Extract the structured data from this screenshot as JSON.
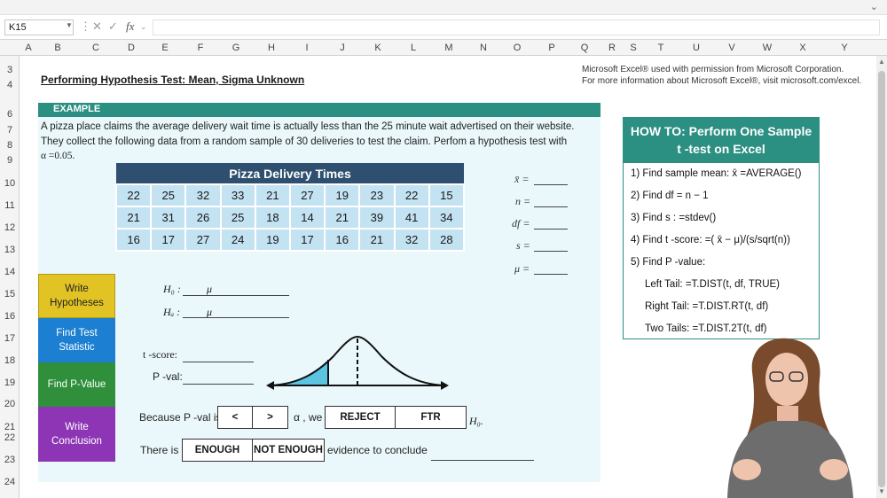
{
  "formula_bar": {
    "cell_ref": "K15",
    "fx": "fx",
    "formula": ""
  },
  "columns": [
    "A",
    "B",
    "C",
    "D",
    "E",
    "F",
    "G",
    "H",
    "I",
    "J",
    "K",
    "L",
    "M",
    "N",
    "O",
    "P",
    "Q",
    "R",
    "S",
    "T",
    "U",
    "V",
    "W",
    "X",
    "Y"
  ],
  "rows": [
    "3",
    "4",
    "6",
    "7",
    "8",
    "9",
    "10",
    "11",
    "12",
    "13",
    "14",
    "15",
    "16",
    "17",
    "18",
    "19",
    "20",
    "21",
    "22",
    "23",
    "24"
  ],
  "title": "Performing Hypothesis Test: Mean, Sigma Unknown",
  "credit": {
    "line1": "Microsoft Excel® used with permission from Microsoft Corporation.",
    "line2": "For more information about Microsoft Excel®, visit microsoft.com/excel."
  },
  "example_label": "EXAMPLE",
  "problem": {
    "line1": "A pizza place claims the average delivery wait time is actually less than the 25 minute wait advertised on their website.",
    "line2": "They collect the following data from a random sample of 30 deliveries to test the claim. Perfom a hypothesis test with",
    "line3": "α =0.05."
  },
  "table": {
    "title": "Pizza Delivery Times",
    "rows": [
      [
        "22",
        "25",
        "32",
        "33",
        "21",
        "27",
        "19",
        "23",
        "22",
        "15"
      ],
      [
        "21",
        "31",
        "26",
        "25",
        "18",
        "14",
        "21",
        "39",
        "41",
        "34"
      ],
      [
        "16",
        "17",
        "27",
        "24",
        "19",
        "17",
        "16",
        "21",
        "32",
        "28"
      ]
    ]
  },
  "stats": {
    "xbar": "x̄ =",
    "n": "n =",
    "df": "df =",
    "s": "s =",
    "mu": "μ ="
  },
  "steps": {
    "hypotheses": "Write Hypotheses",
    "test_stat": "Find Test Statistic",
    "p_value": "Find P-Value",
    "conclusion": "Write Conclusion"
  },
  "hypotheses": {
    "h0": "H₀ :",
    "ha": "Hₐ :",
    "mu": "μ"
  },
  "test_stat": {
    "t_label": "t -score:",
    "p_label": "P -val:"
  },
  "because": {
    "prefix": "Because P -val is",
    "less": "<",
    "greater": ">",
    "alpha_we": "α , we",
    "reject": "REJECT",
    "ftr": "FTR",
    "h0": "H₀."
  },
  "conclusion": {
    "there_is": "There is",
    "enough": "ENOUGH",
    "not_enough": "NOT ENOUGH",
    "evidence": "evidence to conclude"
  },
  "howto": {
    "title_line1": "HOW TO: Perform One Sample",
    "title_line2": "t -test on Excel",
    "step1": "1) Find sample mean:  x̄ =AVERAGE()",
    "step2": "2) Find df = n − 1",
    "step3": "3) Find s : =stdev()",
    "step4": "4) Find t -score: =( x̄ − μ)/(s/sqrt(n))",
    "step5": "5) Find P -value:",
    "left_tail": "Left Tail: =T.DIST(t, df, TRUE)",
    "right_tail": "Right Tail: =T.DIST.RT(t, df)",
    "two_tails": "Two Tails: =T.DIST.2T(t, df)"
  },
  "colors": {
    "teal": "#2b8f82",
    "navy": "#2e4f6f",
    "cell_blue": "#c3e2f2",
    "yellow": "#e1c324",
    "blue": "#1c7fd2",
    "green": "#2f8f3a",
    "purple": "#8e35b6",
    "shade": "#5bc4e0"
  }
}
